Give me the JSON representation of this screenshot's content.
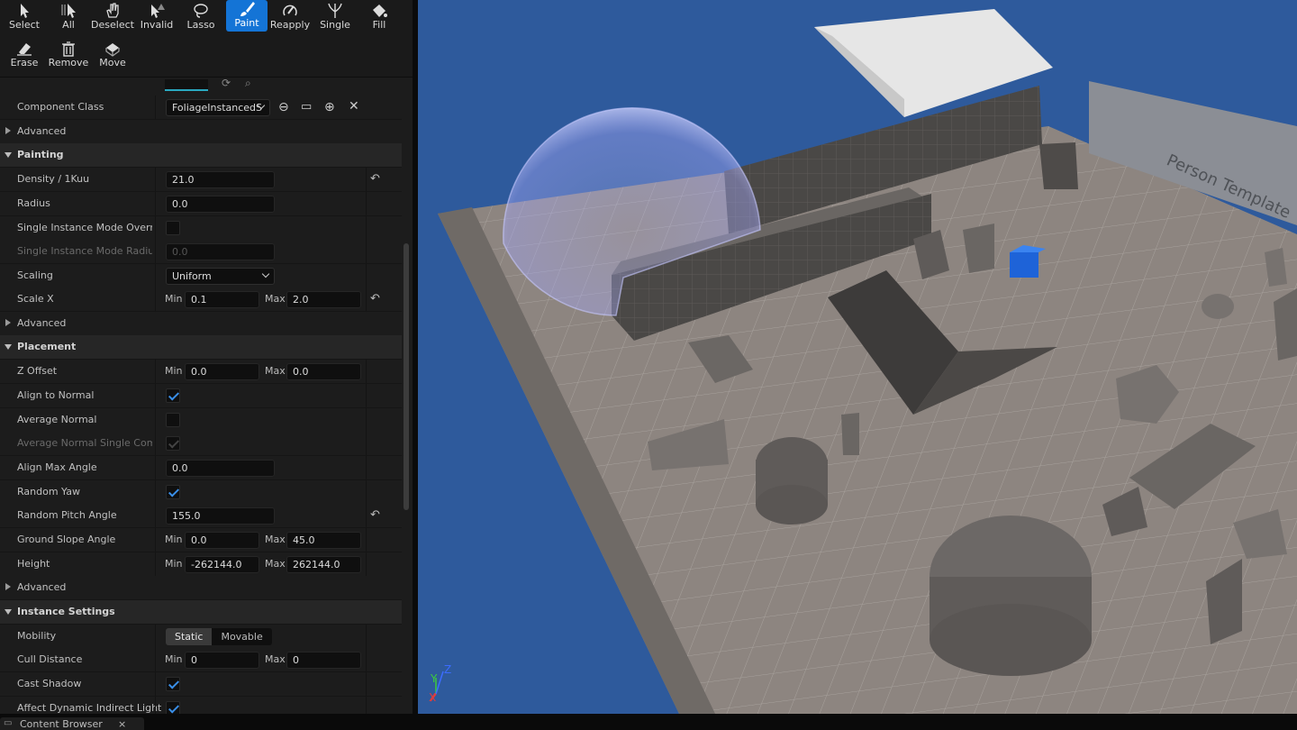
{
  "toolbar": {
    "tools": [
      {
        "label": "Select",
        "icon": "cursor-icon"
      },
      {
        "label": "All",
        "icon": "select-all-icon"
      },
      {
        "label": "Deselect",
        "icon": "hand-icon"
      },
      {
        "label": "Invalid",
        "icon": "invalid-select-icon"
      },
      {
        "label": "Lasso",
        "icon": "lasso-icon"
      },
      {
        "label": "Paint",
        "icon": "paintbrush-icon"
      },
      {
        "label": "Reapply",
        "icon": "reapply-icon"
      },
      {
        "label": "Single",
        "icon": "single-foliage-icon"
      },
      {
        "label": "Fill",
        "icon": "fill-bucket-icon"
      },
      {
        "label": "Erase",
        "icon": "eraser-icon"
      },
      {
        "label": "Remove",
        "icon": "trash-icon"
      },
      {
        "label": "Move",
        "icon": "move-icon"
      }
    ],
    "active_tool": "Paint",
    "accent": "#1474d6"
  },
  "details": {
    "component_class": {
      "label": "Component Class",
      "value": "FoliageInstancedS"
    },
    "advanced_label": "Advanced",
    "painting": {
      "title": "Painting",
      "density": {
        "label": "Density / 1Kuu",
        "value": "21.0"
      },
      "radius": {
        "label": "Radius",
        "value": "0.0"
      },
      "single_override": {
        "label": "Single Instance Mode Overrid...",
        "checked": false
      },
      "single_radius": {
        "label": "Single Instance Mode Radius",
        "value": "0.0"
      },
      "scaling": {
        "label": "Scaling",
        "value": "Uniform"
      },
      "scale_x": {
        "label": "Scale X",
        "min_label": "Min",
        "min": "0.1",
        "max_label": "Max",
        "max": "2.0"
      }
    },
    "placement": {
      "title": "Placement",
      "z_offset": {
        "label": "Z Offset",
        "min_label": "Min",
        "min": "0.0",
        "max_label": "Max",
        "max": "0.0"
      },
      "align_to_normal": {
        "label": "Align to Normal",
        "checked": true
      },
      "average_normal": {
        "label": "Average Normal",
        "checked": false
      },
      "average_normal_single": {
        "label": "Average Normal Single Comp...",
        "checked": true
      },
      "align_max_angle": {
        "label": "Align Max Angle",
        "value": "0.0"
      },
      "random_yaw": {
        "label": "Random Yaw",
        "checked": true
      },
      "random_pitch": {
        "label": "Random Pitch Angle",
        "value": "155.0"
      },
      "ground_slope": {
        "label": "Ground Slope Angle",
        "min_label": "Min",
        "min": "0.0",
        "max_label": "Max",
        "max": "45.0"
      },
      "height": {
        "label": "Height",
        "min_label": "Min",
        "min": "-262144.0",
        "max_label": "Max",
        "max": "262144.0"
      }
    },
    "instance": {
      "title": "Instance Settings",
      "mobility": {
        "label": "Mobility",
        "options": [
          "Static",
          "Movable"
        ],
        "selected": "Static"
      },
      "cull_distance": {
        "label": "Cull Distance",
        "min_label": "Min",
        "min": "0",
        "max_label": "Max",
        "max": "0"
      },
      "cast_shadow": {
        "label": "Cast Shadow",
        "checked": true
      },
      "affect_dynamic": {
        "label": "Affect Dynamic Indirect Lighting",
        "checked": true
      }
    }
  },
  "viewport": {
    "billboard_text": "Person Template",
    "axis_labels": {
      "x": "X",
      "y": "Y",
      "z": "Z"
    },
    "sky_color": "#2e5a9c",
    "floor_color": "#8d8580"
  },
  "bottom": {
    "content_browser_tab": "Content Browser",
    "close_glyph": "×"
  }
}
